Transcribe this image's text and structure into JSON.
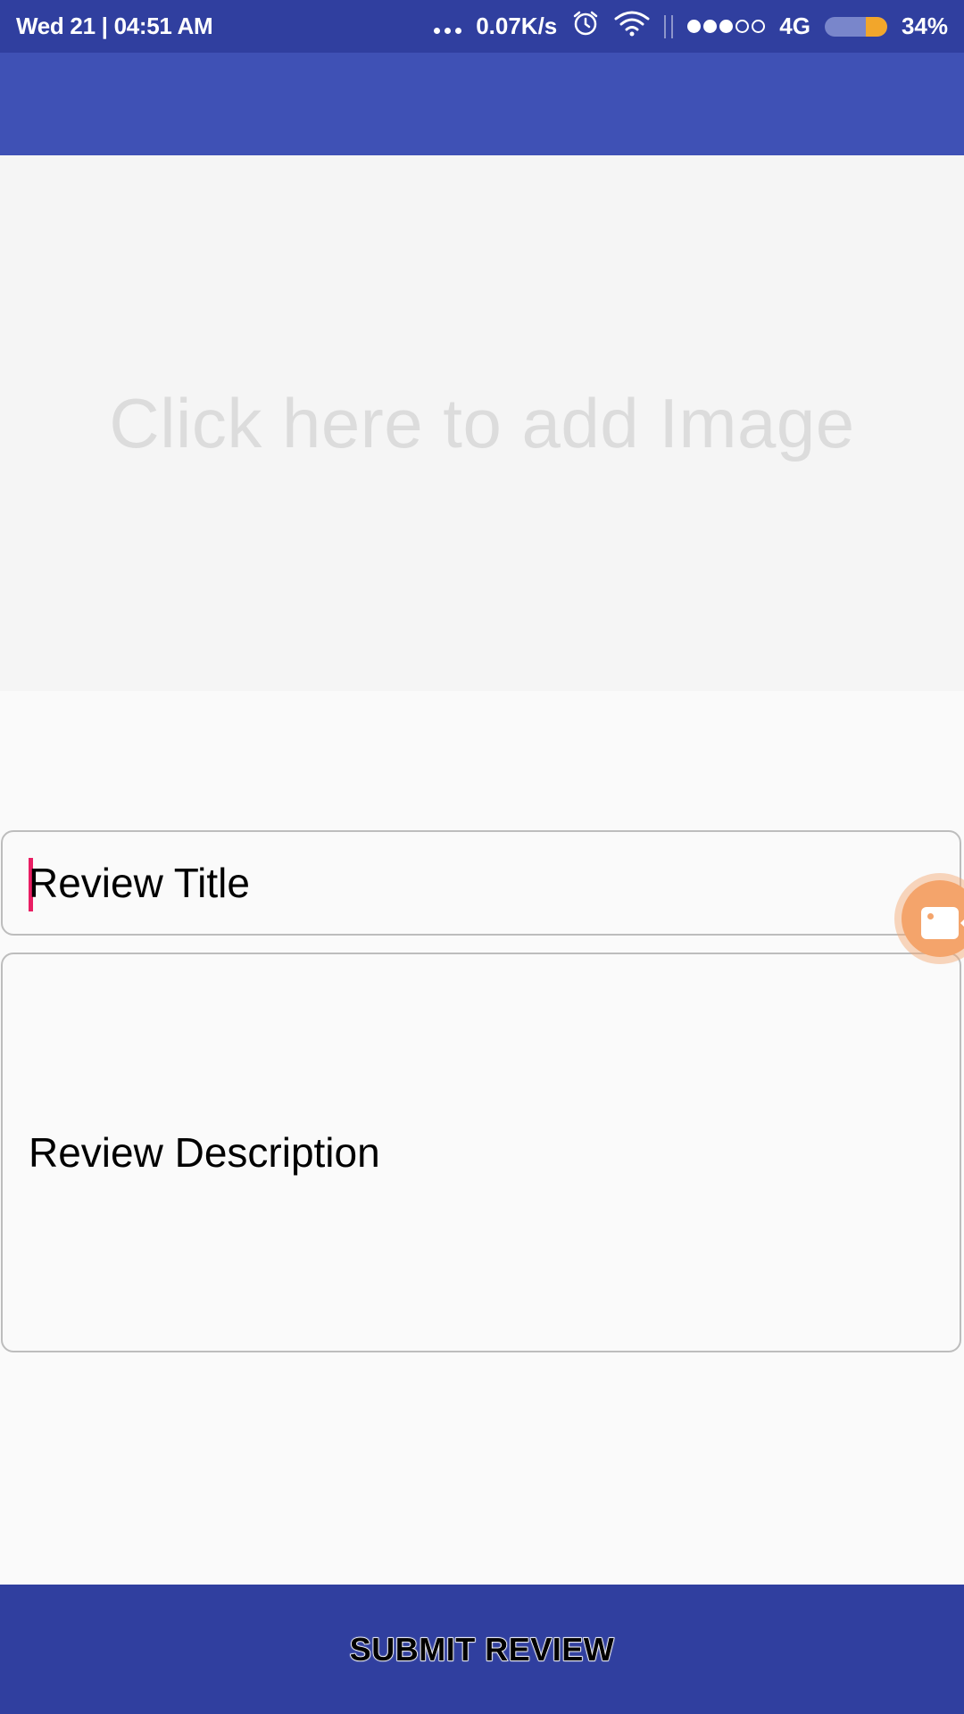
{
  "status_bar": {
    "datetime": "Wed 21 | 04:51 AM",
    "net_speed": "0.07K/s",
    "network_type": "4G",
    "battery_percent": "34%",
    "battery_level": 0.34,
    "signal_strength": 3,
    "signal_max": 5,
    "icons": [
      "more-dots-icon",
      "alarm-icon",
      "wifi-icon",
      "signal-icon",
      "battery-icon"
    ]
  },
  "image_area": {
    "prompt": "Click here to add Image"
  },
  "form": {
    "title_value": "Review Title",
    "description_value": "Review Description"
  },
  "floating_button": {
    "icon": "video-camera-icon",
    "color": "#F4A46B"
  },
  "submit": {
    "label": "SUBMIT REVIEW"
  },
  "colors": {
    "primary": "#3F51B5",
    "primary_dark": "#303F9F",
    "accent": "#E91E63"
  }
}
